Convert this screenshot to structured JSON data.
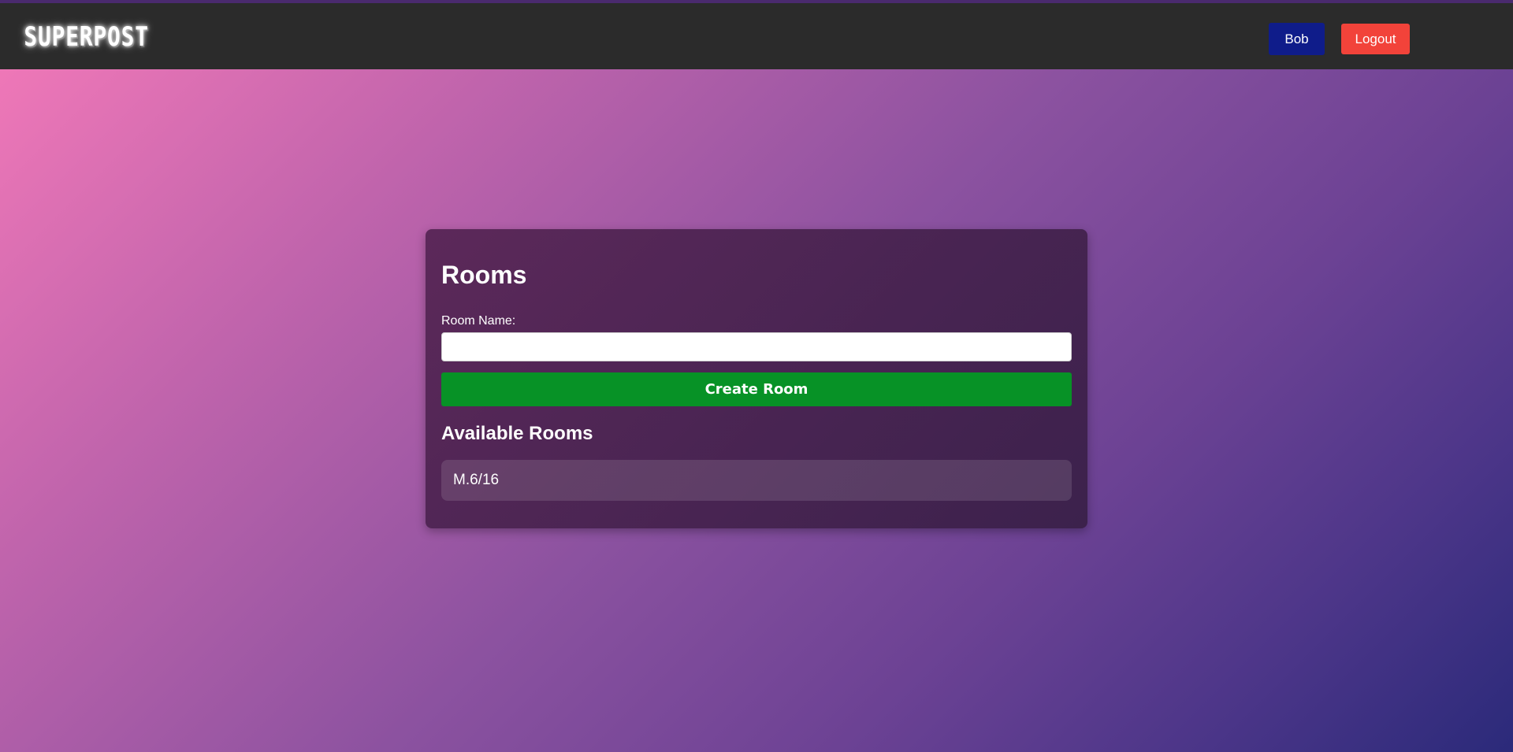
{
  "header": {
    "logo_text": "SUPERPOST",
    "user_button": "Bob",
    "logout_button": "Logout"
  },
  "rooms_card": {
    "title": "Rooms",
    "room_name_label": "Room Name:",
    "room_name_value": "",
    "create_button": "Create Room",
    "available_title": "Available Rooms",
    "rooms": [
      {
        "name": "M.6/16"
      }
    ]
  },
  "colors": {
    "topbar": "#2b2b2b",
    "user_button": "#0f1c8a",
    "logout_button": "#f2433a",
    "create_button": "#079226"
  }
}
